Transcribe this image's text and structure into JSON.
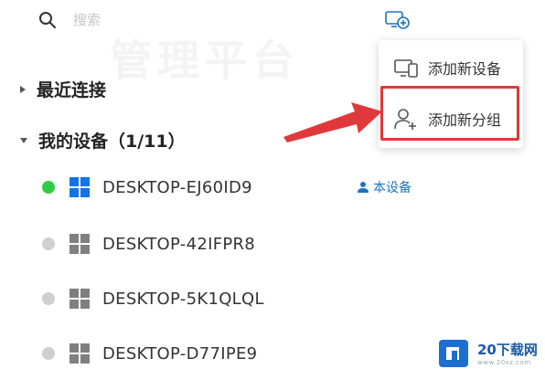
{
  "search": {
    "placeholder": "搜索"
  },
  "watermark": "管理平台",
  "sections": {
    "recent": {
      "title": "最近连接"
    },
    "my_devices": {
      "title": "我的设备",
      "count": "（1/11）"
    }
  },
  "devices": [
    {
      "name": "DESKTOP-EJ60ID9",
      "status": "online"
    },
    {
      "name": "DESKTOP-42IFPR8",
      "status": "offline"
    },
    {
      "name": "DESKTOP-5K1QLQL",
      "status": "offline"
    },
    {
      "name": "DESKTOP-D77IPE9",
      "status": "offline"
    }
  ],
  "this_device_label": "本设备",
  "menu": {
    "items": [
      {
        "label": "添加新设备",
        "icon": "devices-icon"
      },
      {
        "label": "添加新分组",
        "icon": "add-user-icon"
      }
    ]
  },
  "brand": {
    "name": "20下载网",
    "url": "www.20xz.com"
  },
  "colors": {
    "accent": "#1e73be",
    "online": "#2ecc40",
    "offline": "#cfcfcf",
    "highlight": "#e0393b",
    "windows_blue": "#1273eb"
  }
}
